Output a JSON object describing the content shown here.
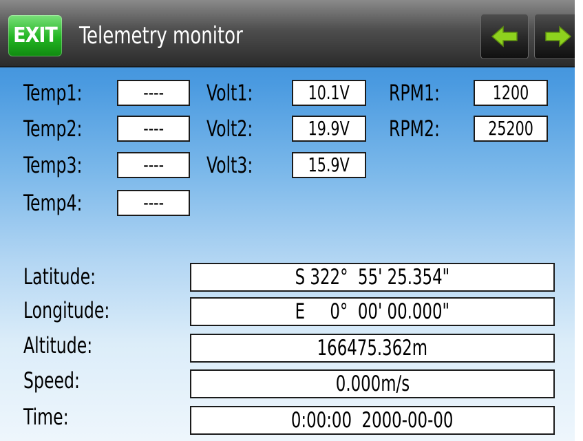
{
  "header": {
    "exit_label": "EXIT",
    "title": "Telemetry monitor",
    "prev_icon": "arrow-left-icon",
    "next_icon": "arrow-right-icon",
    "accent_green": "#22b522",
    "icon_green": "#8ed21e"
  },
  "temps": [
    {
      "label": "Temp1:",
      "value": "----"
    },
    {
      "label": "Temp2:",
      "value": "----"
    },
    {
      "label": "Temp3:",
      "value": "----"
    },
    {
      "label": "Temp4:",
      "value": "----"
    }
  ],
  "volts": [
    {
      "label": "Volt1:",
      "value": "10.1V"
    },
    {
      "label": "Volt2:",
      "value": "19.9V"
    },
    {
      "label": "Volt3:",
      "value": "15.9V"
    }
  ],
  "rpms": [
    {
      "label": "RPM1:",
      "value": "1200"
    },
    {
      "label": "RPM2:",
      "value": "25200"
    }
  ],
  "gps": [
    {
      "label": "Latitude:",
      "value": "S 322°  55' 25.354\""
    },
    {
      "label": "Longitude:",
      "value": "E     0°  00' 00.000\""
    },
    {
      "label": "Altitude:",
      "value": "166475.362m"
    },
    {
      "label": "Speed:",
      "value": "0.000m/s"
    },
    {
      "label": "Time:",
      "value": "0:00:00  2000-00-00"
    }
  ]
}
